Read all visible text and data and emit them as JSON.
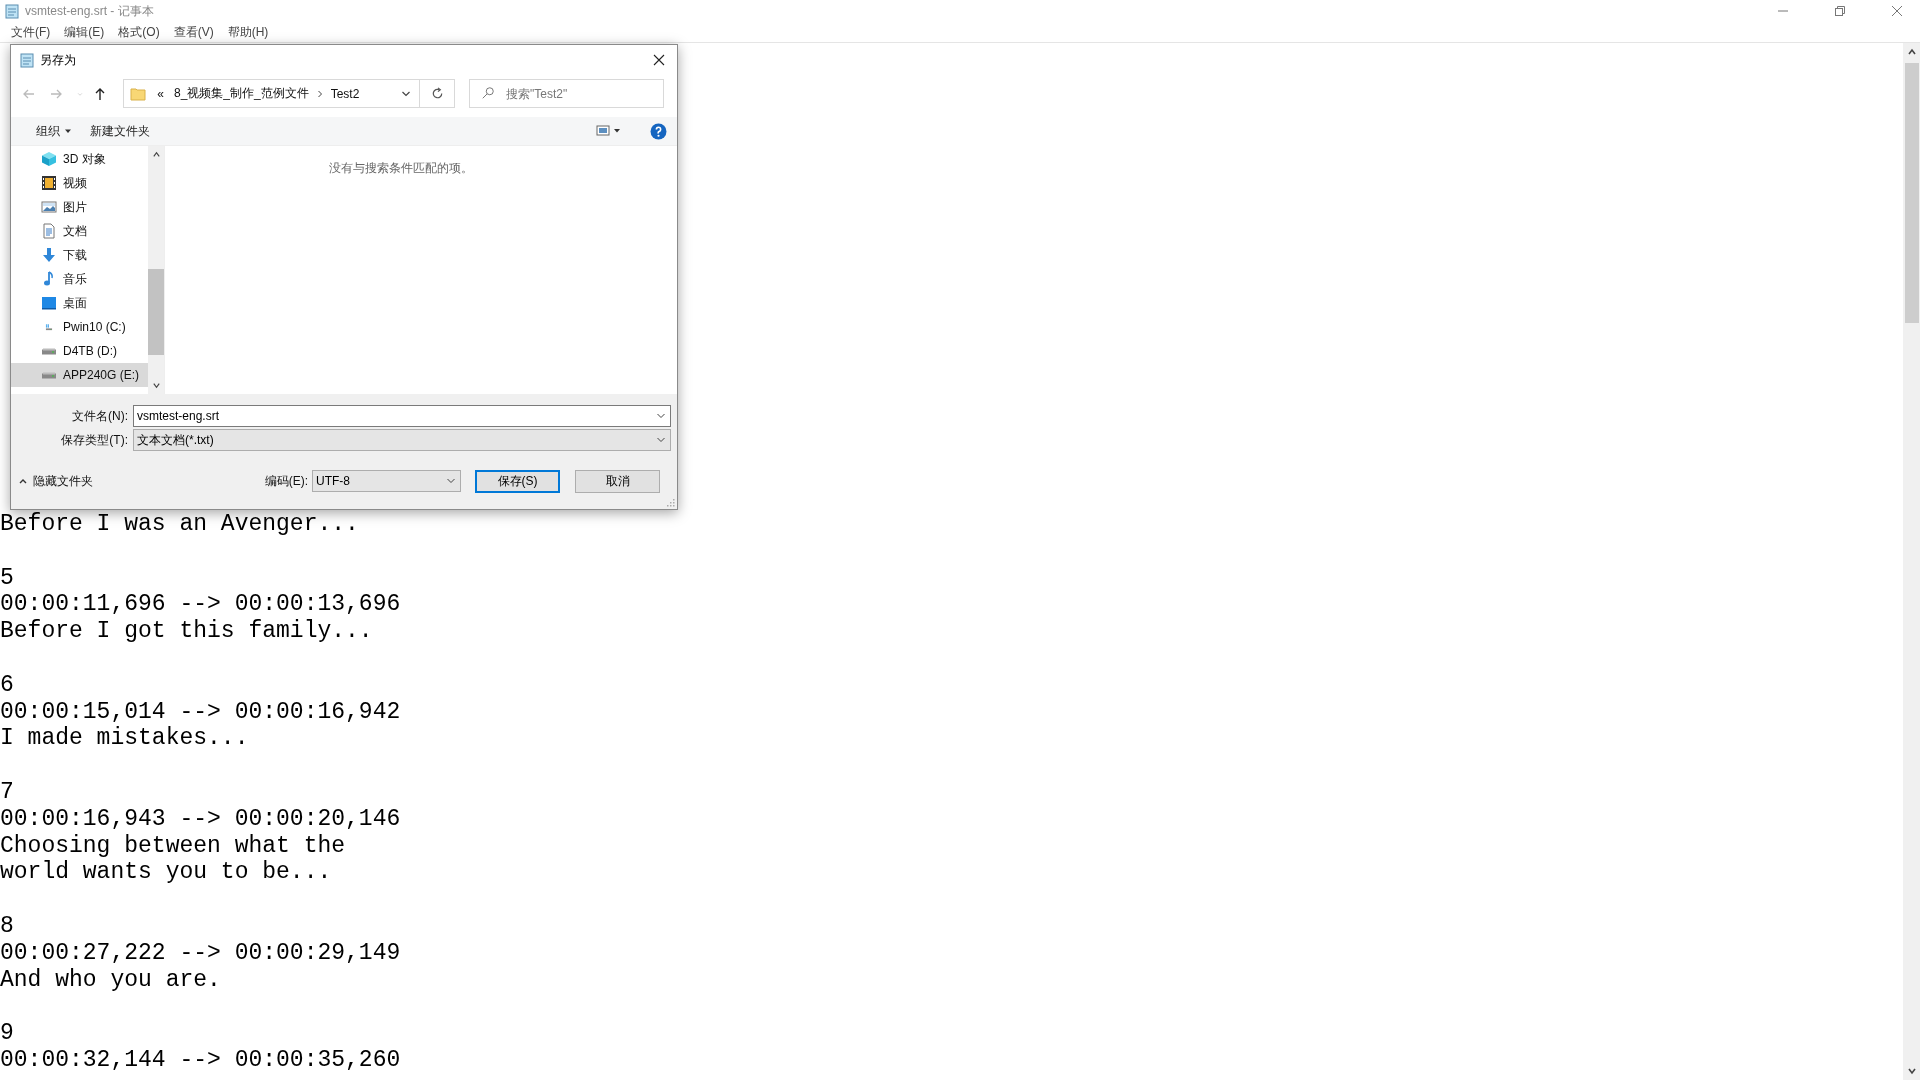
{
  "window": {
    "title": "vsmtest-eng.srt - 记事本"
  },
  "menu": [
    "文件(F)",
    "编辑(E)",
    "格式(O)",
    "查看(V)",
    "帮助(H)"
  ],
  "editor": {
    "cues": [
      {
        "lines": [
          "Before I was an Avenger..."
        ]
      },
      {
        "lines": [
          "5",
          "00:00:11,696 --> 00:00:13,696",
          "Before I got this family..."
        ]
      },
      {
        "lines": [
          "6",
          "00:00:15,014 --> 00:00:16,942",
          "I made mistakes..."
        ]
      },
      {
        "lines": [
          "7",
          "00:00:16,943 --> 00:00:20,146",
          "Choosing between what the",
          "world wants you to be..."
        ]
      },
      {
        "lines": [
          "8",
          "00:00:27,222 --> 00:00:29,149",
          "And who you are."
        ]
      },
      {
        "lines": [
          "9",
          "00:00:32,144 --> 00:00:35,260"
        ]
      }
    ]
  },
  "dialog": {
    "title": "另存为",
    "nav_buttons": [
      {
        "kind": "back",
        "disabled": true
      },
      {
        "kind": "forward",
        "disabled": true
      },
      {
        "kind": "recent",
        "disabled": true
      },
      {
        "kind": "up",
        "disabled": false
      }
    ],
    "breadcrumb": {
      "overflow": "«",
      "items": [
        "8_视频集_制作_范例文件",
        "Test2"
      ]
    },
    "search": {
      "placeholder": "搜索\"Test2\""
    },
    "toolbar": {
      "organize": "组织",
      "new_folder": "新建文件夹"
    },
    "sidebar": {
      "items": [
        {
          "label": "3D 对象",
          "selected": false
        },
        {
          "label": "视频",
          "selected": false
        },
        {
          "label": "图片",
          "selected": false
        },
        {
          "label": "文档",
          "selected": false
        },
        {
          "label": "下载",
          "selected": false
        },
        {
          "label": "音乐",
          "selected": false
        },
        {
          "label": "桌面",
          "selected": false
        },
        {
          "label": "Pwin10 (C:)",
          "selected": false
        },
        {
          "label": "D4TB (D:)",
          "selected": false
        },
        {
          "label": "APP240G (E:)",
          "selected": true
        }
      ]
    },
    "empty_message": "没有与搜索条件匹配的项。",
    "file_name": {
      "label": "文件名(N):",
      "value": "vsmtest-eng.srt"
    },
    "file_type": {
      "label": "保存类型(T):",
      "value": "文本文档(*.txt)"
    },
    "hide_folders": "隐藏文件夹",
    "encoding": {
      "label": "编码(E):",
      "value": "UTF-8"
    },
    "buttons": [
      {
        "label": "保存(S)",
        "default": true
      },
      {
        "label": "取消",
        "default": false
      }
    ]
  }
}
